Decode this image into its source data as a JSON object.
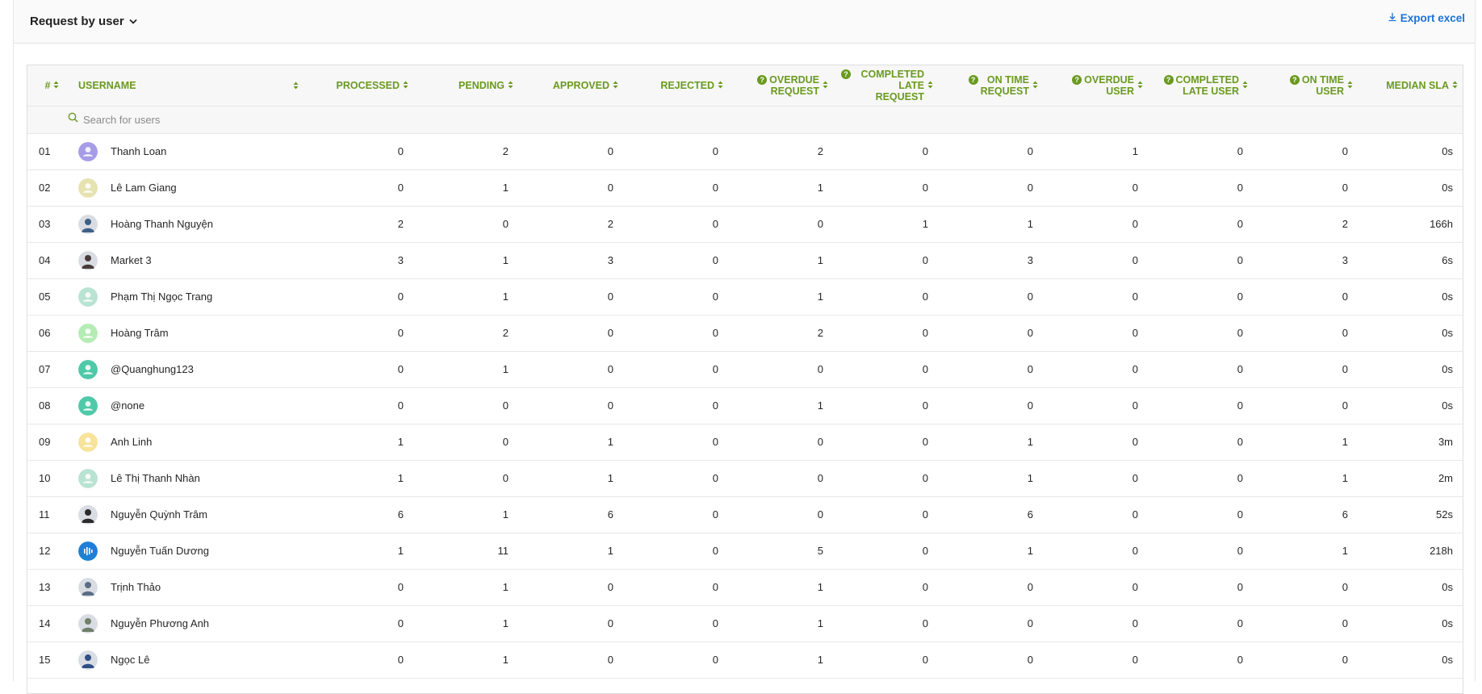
{
  "header": {
    "title": "Request by user",
    "export_label": "Export excel"
  },
  "search": {
    "placeholder": "Search for users"
  },
  "columns": [
    {
      "label": "#",
      "help": false
    },
    {
      "label": "USERNAME",
      "help": false
    },
    {
      "label": "PROCESSED",
      "help": false
    },
    {
      "label": "PENDING",
      "help": false
    },
    {
      "label": "APPROVED",
      "help": false
    },
    {
      "label": "REJECTED",
      "help": false
    },
    {
      "label_line1": "OVERDUE",
      "label_line2": "REQUEST",
      "help": true
    },
    {
      "label_line1": "COMPLETED",
      "label_line2": "LATE REQUEST",
      "help": true
    },
    {
      "label_line1": "ON TIME",
      "label_line2": "REQUEST",
      "help": true
    },
    {
      "label_line1": "OVERDUE",
      "label_line2": "USER",
      "help": true
    },
    {
      "label_line1": "COMPLETED",
      "label_line2": "LATE USER",
      "help": true
    },
    {
      "label_line1": "ON TIME",
      "label_line2": "USER",
      "help": true
    },
    {
      "label": "MEDIAN SLA",
      "help": false
    }
  ],
  "rows": [
    {
      "idx": "01",
      "name": "Thanh Loan",
      "avatar": "person-icon",
      "avatar_color": "#a59ce8",
      "vals": [
        "0",
        "2",
        "0",
        "0",
        "2",
        "0",
        "0",
        "1",
        "0",
        "0",
        "0s"
      ]
    },
    {
      "idx": "02",
      "name": "Lê Lam Giang",
      "avatar": "person-icon",
      "avatar_color": "#e6e3b2",
      "vals": [
        "0",
        "1",
        "0",
        "0",
        "1",
        "0",
        "0",
        "0",
        "0",
        "0",
        "0s"
      ]
    },
    {
      "idx": "03",
      "name": "Hoàng Thanh Nguyện",
      "avatar": "photo-avatar",
      "avatar_color": "#3f5f86",
      "vals": [
        "2",
        "0",
        "2",
        "0",
        "0",
        "1",
        "1",
        "0",
        "0",
        "2",
        "166h"
      ]
    },
    {
      "idx": "04",
      "name": "Market 3",
      "avatar": "photo-avatar",
      "avatar_color": "#4a3b3b",
      "vals": [
        "3",
        "1",
        "3",
        "0",
        "1",
        "0",
        "3",
        "0",
        "0",
        "3",
        "6s"
      ]
    },
    {
      "idx": "05",
      "name": "Phạm Thị Ngọc Trang",
      "avatar": "person-icon",
      "avatar_color": "#b9e3d3",
      "vals": [
        "0",
        "1",
        "0",
        "0",
        "1",
        "0",
        "0",
        "0",
        "0",
        "0",
        "0s"
      ]
    },
    {
      "idx": "06",
      "name": "Hoàng Trâm",
      "avatar": "person-icon",
      "avatar_color": "#b5ecb5",
      "vals": [
        "0",
        "2",
        "0",
        "0",
        "2",
        "0",
        "0",
        "0",
        "0",
        "0",
        "0s"
      ]
    },
    {
      "idx": "07",
      "name": "@Quanghung123",
      "avatar": "person-icon",
      "avatar_color": "#4fc9a8",
      "vals": [
        "0",
        "1",
        "0",
        "0",
        "0",
        "0",
        "0",
        "0",
        "0",
        "0",
        "0s"
      ]
    },
    {
      "idx": "08",
      "name": "@none",
      "avatar": "person-icon",
      "avatar_color": "#4fc9a8",
      "vals": [
        "0",
        "0",
        "0",
        "0",
        "1",
        "0",
        "0",
        "0",
        "0",
        "0",
        "0s"
      ]
    },
    {
      "idx": "09",
      "name": "Anh Linh",
      "avatar": "person-icon",
      "avatar_color": "#f7e49a",
      "vals": [
        "1",
        "0",
        "1",
        "0",
        "0",
        "0",
        "1",
        "0",
        "0",
        "1",
        "3m"
      ]
    },
    {
      "idx": "10",
      "name": "Lê Thị Thanh Nhàn",
      "avatar": "person-icon",
      "avatar_color": "#b9e3d3",
      "vals": [
        "1",
        "0",
        "1",
        "0",
        "0",
        "0",
        "1",
        "0",
        "0",
        "1",
        "2m"
      ]
    },
    {
      "idx": "11",
      "name": "Nguyễn Quỳnh Trâm",
      "avatar": "photo-avatar",
      "avatar_color": "#2a2a2a",
      "vals": [
        "6",
        "1",
        "6",
        "0",
        "0",
        "0",
        "6",
        "0",
        "0",
        "6",
        "52s"
      ]
    },
    {
      "idx": "12",
      "name": "Nguyễn Tuấn Dương",
      "avatar": "logo-avatar",
      "avatar_color": "#1f7fd6",
      "vals": [
        "1",
        "11",
        "1",
        "0",
        "5",
        "0",
        "1",
        "0",
        "0",
        "1",
        "218h"
      ]
    },
    {
      "idx": "13",
      "name": "Trịnh Thảo",
      "avatar": "photo-avatar",
      "avatar_color": "#5b6d86",
      "vals": [
        "0",
        "1",
        "0",
        "0",
        "1",
        "0",
        "0",
        "0",
        "0",
        "0",
        "0s"
      ]
    },
    {
      "idx": "14",
      "name": "Nguyễn Phương Anh",
      "avatar": "photo-avatar",
      "avatar_color": "#6f7f6a",
      "vals": [
        "0",
        "1",
        "0",
        "0",
        "1",
        "0",
        "0",
        "0",
        "0",
        "0",
        "0s"
      ]
    },
    {
      "idx": "15",
      "name": "Ngọc Lê",
      "avatar": "photo-avatar",
      "avatar_color": "#2f4f86",
      "vals": [
        "0",
        "1",
        "0",
        "0",
        "1",
        "0",
        "0",
        "0",
        "0",
        "0",
        "0s"
      ]
    }
  ]
}
